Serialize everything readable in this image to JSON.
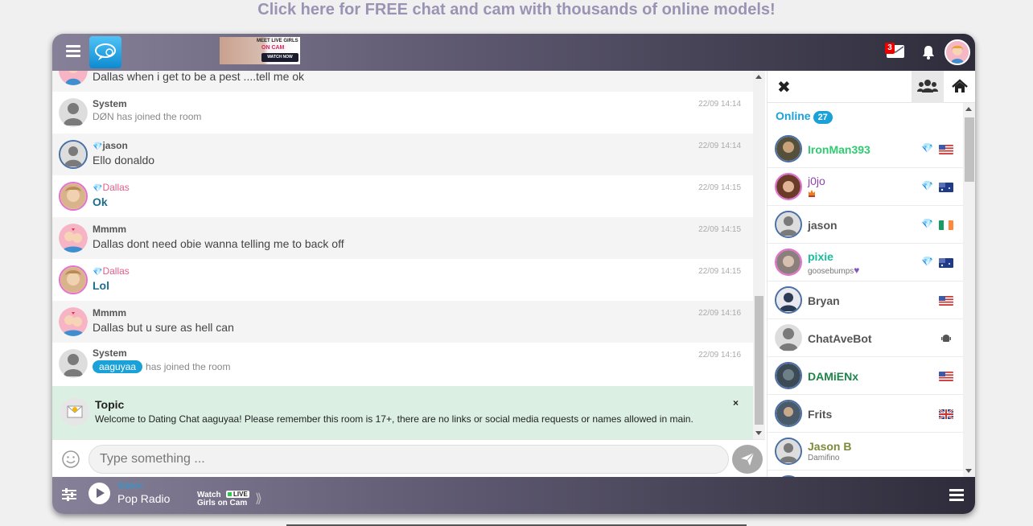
{
  "promo": {
    "text": "Click here for FREE chat and cam with thousands of online models!"
  },
  "topbar": {
    "ad": {
      "line1": "MEET LIVE GIRLS",
      "line2": "ON CAM",
      "button": "WATCH NOW"
    },
    "mail_count": "3"
  },
  "chat": {
    "partial_message": {
      "text": "Dallas when i get to be a pest ....tell me ok"
    },
    "messages": [
      {
        "name": "System",
        "text": "DØN has joined the room",
        "time": "22/09 14:14"
      },
      {
        "name": "jason",
        "text": "Ello donaldo",
        "time": "22/09 14:14"
      },
      {
        "name": "Dallas",
        "text": "Ok",
        "time": "22/09 14:15"
      },
      {
        "name": "Mmmm",
        "text": "Dallas dont need obie wanna telling me to back off",
        "time": "22/09 14:15"
      },
      {
        "name": "Dallas",
        "text": "Lol",
        "time": "22/09 14:15"
      },
      {
        "name": "Mmmm",
        "text": "Dallas but u sure as hell can",
        "time": "22/09 14:16"
      },
      {
        "name": "System",
        "pill": "aaguyaa",
        "text": "has joined the room",
        "time": "22/09 14:16"
      }
    ],
    "topic": {
      "title": "Topic",
      "text": "Welcome to Dating Chat aaguyaa! Please remember this room is 17+, there are no links or social media requests or names allowed in main.",
      "close": "×"
    }
  },
  "input": {
    "placeholder": "Type something ..."
  },
  "panel": {
    "online_label": "Online",
    "online_count": "27",
    "users": [
      {
        "name": "IronMan393",
        "color": "#2ecc71",
        "gem": true,
        "flag": "us"
      },
      {
        "name": "j0jo",
        "color": "#8e44ad",
        "gem": true,
        "flag": "au"
      },
      {
        "name": "jason",
        "color": "#555555",
        "gem": true,
        "flag": "ie"
      },
      {
        "name": "pixie",
        "sub": "goosebumps",
        "color": "#1abc9c",
        "gem": true,
        "flag": "au"
      },
      {
        "name": "Bryan",
        "color": "#555555",
        "gem": false,
        "flag": "us"
      },
      {
        "name": "ChatAveBot",
        "color": "#555555",
        "gem": false,
        "flag": "android"
      },
      {
        "name": "DAMiENx",
        "color": "#1e8449",
        "gem": false,
        "flag": "us"
      },
      {
        "name": "Frits",
        "color": "#555555",
        "gem": false,
        "flag": "uk"
      },
      {
        "name": "Jason B",
        "sub": "Damifino",
        "color": "#7d8a3c",
        "gem": false,
        "flag": ""
      }
    ]
  },
  "radio": {
    "station_label": "Station",
    "station_name": "Pop Radio"
  },
  "watch": {
    "line1": "Watch",
    "live": "LIVE",
    "line2": "Girls on Cam"
  }
}
